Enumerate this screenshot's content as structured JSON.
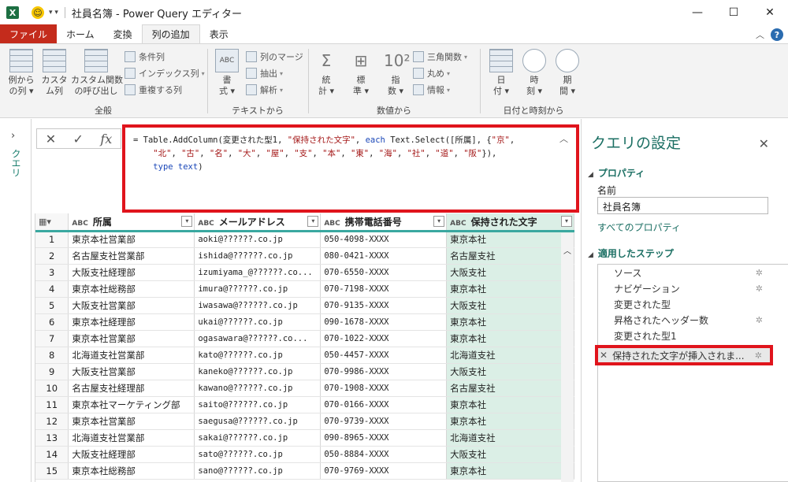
{
  "window": {
    "title": "社員名簿 - Power Query エディター",
    "app_icon": "X",
    "minimize": "—",
    "maximize": "☐",
    "close": "✕"
  },
  "tabs": [
    {
      "label": "ファイル",
      "kind": "file"
    },
    {
      "label": "ホーム",
      "kind": "normal"
    },
    {
      "label": "変換",
      "kind": "normal"
    },
    {
      "label": "列の追加",
      "kind": "active"
    },
    {
      "label": "表示",
      "kind": "normal"
    }
  ],
  "ribbon": {
    "general": {
      "group_label": "全般",
      "example_col": "例から\nの列 ▾",
      "custom_col": "カスタ\nム列",
      "custom_func": "カスタム関数\nの呼び出し",
      "conditional": "条件列",
      "index": "インデックス列",
      "duplicate": "重複する列"
    },
    "text": {
      "group_label": "テキストから",
      "format": "書\n式 ▾",
      "merge": "列のマージ",
      "extract": "抽出",
      "parse": "解析"
    },
    "number": {
      "group_label": "数値から",
      "stats": "統\n計 ▾",
      "standard": "標\n準 ▾",
      "scientific": "指\n数 ▾",
      "trig": "三角関数",
      "rounding": "丸め",
      "info": "情報"
    },
    "datetime": {
      "group_label": "日付と時刻から",
      "date": "日\n付 ▾",
      "time": "時\n刻 ▾",
      "duration": "期\n間 ▾"
    }
  },
  "left_pane": {
    "label": "クエリ"
  },
  "formula_bar": {
    "cancel": "✕",
    "commit": "✓",
    "fx": "fx"
  },
  "table": {
    "columns": [
      "所属",
      "メールアドレス",
      "携帯電話番号",
      "保持された文字"
    ],
    "rows": [
      [
        "1",
        "東京本社営業部",
        "aoki@??????.co.jp",
        "050-4098-XXXX",
        "東京本社"
      ],
      [
        "2",
        "名古屋支社営業部",
        "ishida@??????.co.jp",
        "080-0421-XXXX",
        "名古屋支社"
      ],
      [
        "3",
        "大阪支社経理部",
        "izumiyama_@??????.co...",
        "070-6550-XXXX",
        "大阪支社"
      ],
      [
        "4",
        "東京本社総務部",
        "imura@??????.co.jp",
        "070-7198-XXXX",
        "東京本社"
      ],
      [
        "5",
        "大阪支社営業部",
        "iwasawa@??????.co.jp",
        "070-9135-XXXX",
        "大阪支社"
      ],
      [
        "6",
        "東京本社経理部",
        "ukai@??????.co.jp",
        "090-1678-XXXX",
        "東京本社"
      ],
      [
        "7",
        "東京本社営業部",
        "ogasawara@??????.co...",
        "070-1022-XXXX",
        "東京本社"
      ],
      [
        "8",
        "北海道支社営業部",
        "kato@??????.co.jp",
        "050-4457-XXXX",
        "北海道支社"
      ],
      [
        "9",
        "大阪支社営業部",
        "kaneko@??????.co.jp",
        "070-9986-XXXX",
        "大阪支社"
      ],
      [
        "10",
        "名古屋支社経理部",
        "kawano@??????.co.jp",
        "070-1908-XXXX",
        "名古屋支社"
      ],
      [
        "11",
        "東京本社マーケティング部",
        "saito@??????.co.jp",
        "070-0166-XXXX",
        "東京本社"
      ],
      [
        "12",
        "東京本社営業部",
        "saegusa@??????.co.jp",
        "070-9739-XXXX",
        "東京本社"
      ],
      [
        "13",
        "北海道支社営業部",
        "sakai@??????.co.jp",
        "090-8965-XXXX",
        "北海道支社"
      ],
      [
        "14",
        "大阪支社経理部",
        "sato@??????.co.jp",
        "050-8884-XXXX",
        "大阪支社"
      ],
      [
        "15",
        "東京本社総務部",
        "sano@??????.co.jp",
        "070-9769-XXXX",
        "東京本社"
      ]
    ]
  },
  "settings": {
    "title": "クエリの設定",
    "properties_header": "プロパティ",
    "name_label": "名前",
    "name_value": "社員名簿",
    "all_props": "すべてのプロパティ",
    "steps_header": "適用したステップ",
    "steps": [
      {
        "label": "ソース",
        "gear": true
      },
      {
        "label": "ナビゲーション",
        "gear": true
      },
      {
        "label": "変更された型",
        "gear": false
      },
      {
        "label": "昇格されたヘッダー数",
        "gear": true
      },
      {
        "label": "変更された型1",
        "gear": false
      },
      {
        "label": "保持された文字が挿入されま...",
        "gear": true,
        "selected": true
      }
    ]
  },
  "colors": {
    "excel_green": "#1d6f42",
    "file_tab": "#c42b1c",
    "highlight_red": "#e0141c",
    "teal": "#1b6f63",
    "new_column_bg": "#dbefe6"
  }
}
